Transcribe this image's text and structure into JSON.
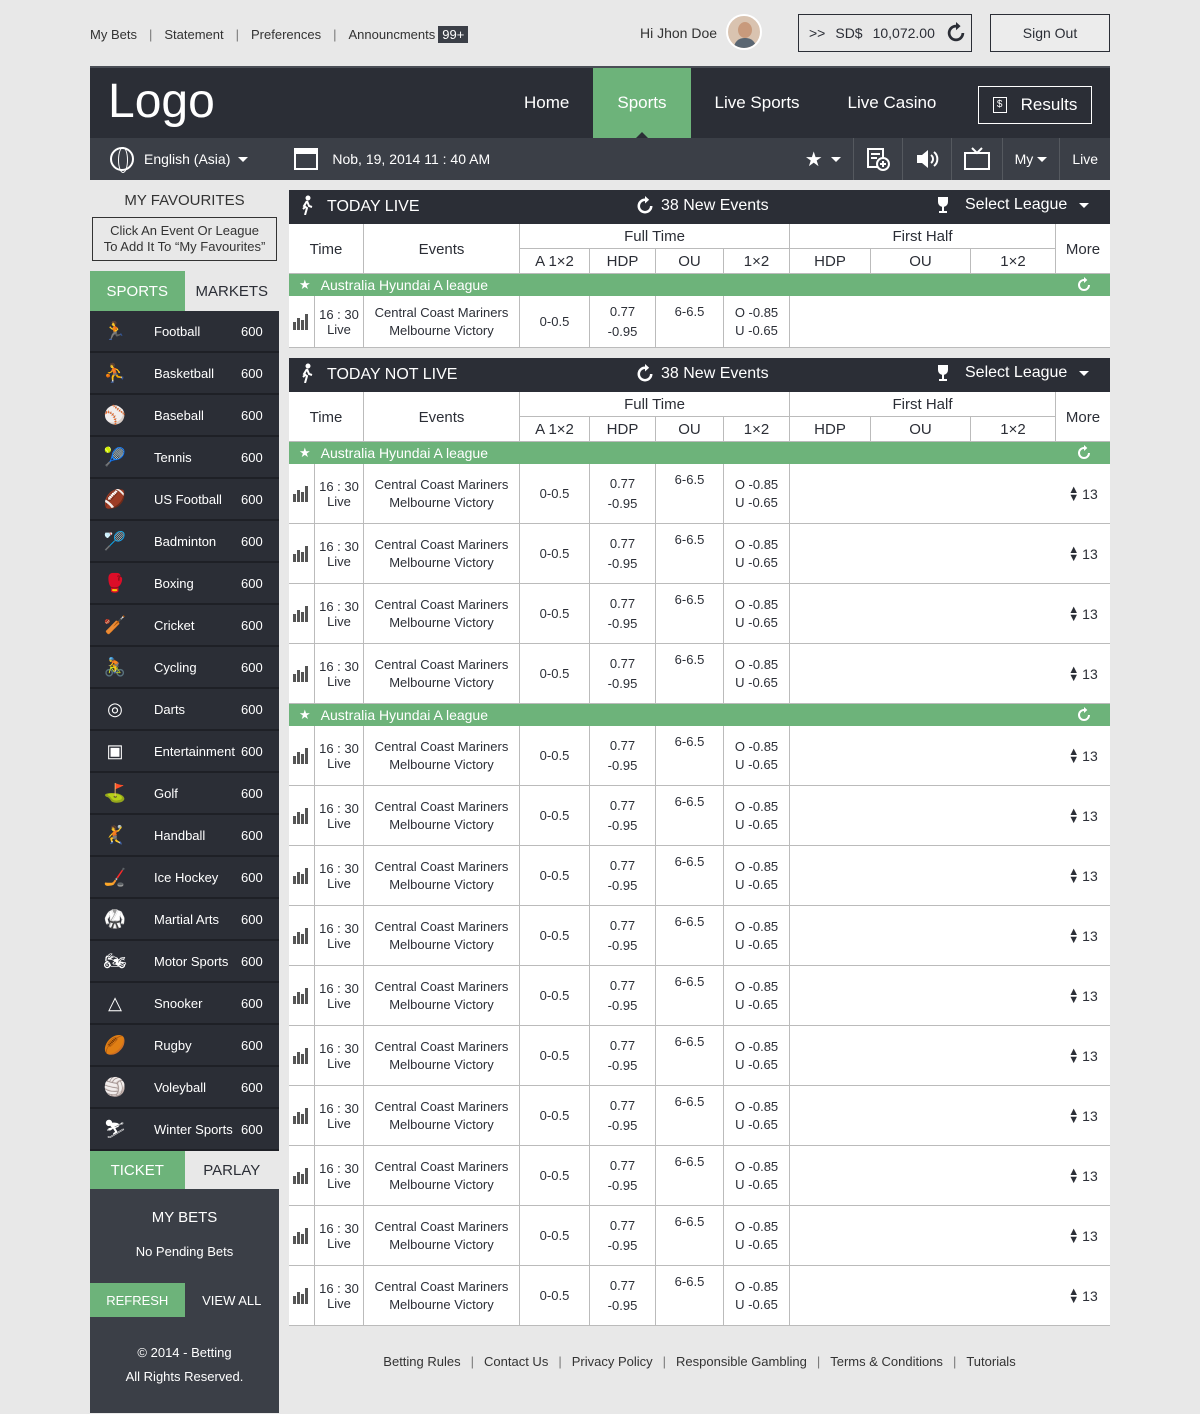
{
  "top": {
    "links": [
      "My Bets",
      "Statement",
      "Preferences",
      "Announcments"
    ],
    "badge": "99+",
    "greeting": "Hi Jhon Doe",
    "balance_prefix": ">>",
    "currency": "SD$",
    "balance": "10,072.00",
    "sign_out": "Sign Out"
  },
  "header": {
    "logo": "Logo",
    "nav": [
      "Home",
      "Sports",
      "Live Sports",
      "Live Casino"
    ],
    "active_nav": "Sports",
    "results": "Results"
  },
  "subbar": {
    "language": "English (Asia)",
    "datetime": "Nob, 19, 2014 11 : 40 AM",
    "my": "My",
    "live": "Live"
  },
  "sidebar": {
    "fav_title": "MY FAVOURITES",
    "fav_hint_line1": "Click An Event Or League",
    "fav_hint_line2": "To Add It To “My Favourites”",
    "tabs": [
      "SPORTS",
      "MARKETS"
    ],
    "sports": [
      {
        "name": "Football",
        "count": "600",
        "icon": "football-icon"
      },
      {
        "name": "Basketball",
        "count": "600",
        "icon": "basketball-icon"
      },
      {
        "name": "Baseball",
        "count": "600",
        "icon": "baseball-icon"
      },
      {
        "name": "Tennis",
        "count": "600",
        "icon": "tennis-icon"
      },
      {
        "name": "US Football",
        "count": "600",
        "icon": "us-football-icon"
      },
      {
        "name": "Badminton",
        "count": "600",
        "icon": "badminton-icon"
      },
      {
        "name": "Boxing",
        "count": "600",
        "icon": "boxing-icon"
      },
      {
        "name": "Cricket",
        "count": "600",
        "icon": "cricket-icon"
      },
      {
        "name": "Cycling",
        "count": "600",
        "icon": "cycling-icon"
      },
      {
        "name": "Darts",
        "count": "600",
        "icon": "darts-icon"
      },
      {
        "name": "Entertainment",
        "count": "600",
        "icon": "entertainment-icon"
      },
      {
        "name": "Golf",
        "count": "600",
        "icon": "golf-icon"
      },
      {
        "name": "Handball",
        "count": "600",
        "icon": "handball-icon"
      },
      {
        "name": "Ice Hockey",
        "count": "600",
        "icon": "ice-hockey-icon"
      },
      {
        "name": "Martial Arts",
        "count": "600",
        "icon": "martial-arts-icon"
      },
      {
        "name": "Motor Sports",
        "count": "600",
        "icon": "motor-sports-icon"
      },
      {
        "name": "Snooker",
        "count": "600",
        "icon": "snooker-icon"
      },
      {
        "name": "Rugby",
        "count": "600",
        "icon": "rugby-icon"
      },
      {
        "name": "Voleyball",
        "count": "600",
        "icon": "volleyball-icon"
      },
      {
        "name": "Winter Sports",
        "count": "600",
        "icon": "winter-sports-icon"
      }
    ],
    "ticket_tabs": [
      "TICKET",
      "PARLAY"
    ],
    "mybets_title": "MY BETS",
    "no_pending": "No Pending Bets",
    "refresh": "REFRESH",
    "view_all": "VIEW ALL",
    "copyright": "© 2014 - Betting",
    "rights": "All Rights Reserved."
  },
  "columns": {
    "time": "Time",
    "events": "Events",
    "full_time": "Full Time",
    "first_half": "First Half",
    "more": "More",
    "a1x2": "A 1×2",
    "hdp": "HDP",
    "ou": "OU",
    "one_x2": "1×2"
  },
  "sections": [
    {
      "title": "TODAY LIVE",
      "new_events": "38 New Events",
      "select_league": "Select League",
      "leagues": [
        {
          "name": "Australia Hyundai A league",
          "rows": 1
        }
      ],
      "show_more": false
    },
    {
      "title": "TODAY NOT LIVE",
      "new_events": "38 New Events",
      "select_league": "Select League",
      "leagues": [
        {
          "name": "Australia Hyundai A league",
          "rows": 4
        },
        {
          "name": "Australia Hyundai A league",
          "rows": 10
        }
      ],
      "show_more": true
    }
  ],
  "match": {
    "time": "16 : 30",
    "status": "Live",
    "home": "Central Coast Mariners",
    "away": "Melbourne Victory",
    "a1x2": "0-0.5",
    "hdp_1": "0.77",
    "hdp_2": "-0.95",
    "ou": "6-6.5",
    "o": "O  -0.85",
    "u": "U  -0.65",
    "more": "13"
  },
  "footer": [
    "Betting Rules",
    "Contact Us",
    "Privacy Policy",
    "Responsible Gambling",
    "Terms & Conditions",
    "Tutorials"
  ],
  "colors": {
    "dark": "#2b2e36",
    "green": "#6db37a",
    "subbar": "#3b3f47"
  }
}
